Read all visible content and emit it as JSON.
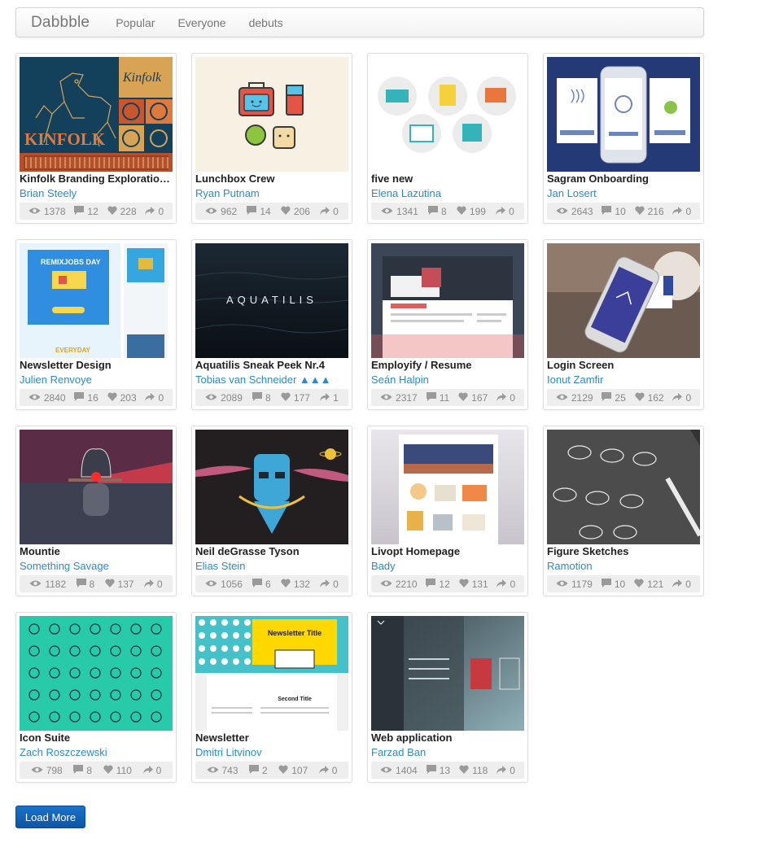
{
  "nav": {
    "brand": "Dabbble",
    "links": [
      "Popular",
      "Everyone",
      "debuts"
    ]
  },
  "shots": [
    {
      "title": "Kinfolk Branding Exploration...",
      "author": "Brian Steely",
      "views": "1378",
      "comments": "12",
      "likes": "228",
      "rebounds": "0",
      "thumb": "kinfolk"
    },
    {
      "title": "Lunchbox Crew",
      "author": "Ryan Putnam",
      "views": "962",
      "comments": "14",
      "likes": "206",
      "rebounds": "0",
      "thumb": "lunchbox"
    },
    {
      "title": "five new",
      "author": "Elena Lazutina",
      "views": "1341",
      "comments": "8",
      "likes": "199",
      "rebounds": "0",
      "thumb": "fivenew"
    },
    {
      "title": "Sagram Onboarding",
      "author": "Jan Losert",
      "views": "2643",
      "comments": "10",
      "likes": "216",
      "rebounds": "0",
      "thumb": "sagram"
    },
    {
      "title": "Newsletter Design",
      "author": "Julien Renvoye",
      "views": "2840",
      "comments": "16",
      "likes": "203",
      "rebounds": "0",
      "thumb": "newsletterdesign"
    },
    {
      "title": "Aquatilis Sneak Peek Nr.4",
      "author": "Tobias van Schneider ▲▲▲",
      "views": "2089",
      "comments": "8",
      "likes": "177",
      "rebounds": "1",
      "thumb": "aquatilis"
    },
    {
      "title": "Employify / Resume",
      "author": "Seán Halpin",
      "views": "2317",
      "comments": "11",
      "likes": "167",
      "rebounds": "0",
      "thumb": "employify"
    },
    {
      "title": "Login Screen",
      "author": "Ionut Zamfir",
      "views": "2129",
      "comments": "25",
      "likes": "162",
      "rebounds": "0",
      "thumb": "login"
    },
    {
      "title": "Mountie",
      "author": "Something Savage",
      "views": "1182",
      "comments": "8",
      "likes": "137",
      "rebounds": "0",
      "thumb": "mountie"
    },
    {
      "title": "Neil deGrasse Tyson",
      "author": "Elias Stein",
      "views": "1056",
      "comments": "6",
      "likes": "132",
      "rebounds": "0",
      "thumb": "tyson"
    },
    {
      "title": "Livopt Homepage",
      "author": "Bady",
      "views": "2210",
      "comments": "12",
      "likes": "131",
      "rebounds": "0",
      "thumb": "livopt"
    },
    {
      "title": "Figure Sketches",
      "author": "Ramotion",
      "views": "1179",
      "comments": "10",
      "likes": "121",
      "rebounds": "0",
      "thumb": "sketches"
    },
    {
      "title": "Icon Suite",
      "author": "Zach Roszczewski",
      "views": "798",
      "comments": "8",
      "likes": "110",
      "rebounds": "0",
      "thumb": "iconsuite"
    },
    {
      "title": "Newsletter",
      "author": "Dmitri Litvinov",
      "views": "743",
      "comments": "2",
      "likes": "107",
      "rebounds": "0",
      "thumb": "newsletter"
    },
    {
      "title": "Web application",
      "author": "Farzad Ban",
      "views": "1404",
      "comments": "13",
      "likes": "118",
      "rebounds": "0",
      "thumb": "webapp"
    }
  ],
  "thumb_text": {
    "kinfolk": [
      "KINFOLK",
      "Kinfolk"
    ],
    "newsletterdesign": [
      "REMIXJOBS DAY",
      "EVERYDAY"
    ],
    "aquatilis": [
      "AQUATILIS"
    ],
    "newsletter": [
      "Newsletter Title",
      "Second Title"
    ]
  },
  "load_more": "Load More",
  "colors": {
    "link": "#2a8ccf",
    "button": "#1565c0",
    "stats_bg": "#eeeeee"
  }
}
